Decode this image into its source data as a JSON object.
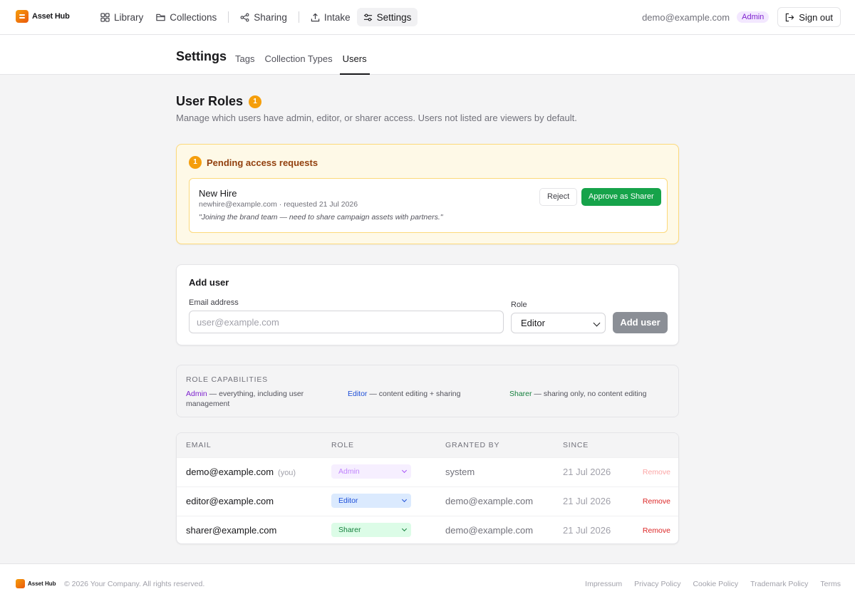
{
  "brand": {
    "name": "Asset Hub"
  },
  "nav": {
    "items": [
      {
        "label": "Library",
        "icon": "grid-icon"
      },
      {
        "label": "Collections",
        "icon": "folder-icon"
      },
      {
        "label": "Sharing",
        "icon": "share-icon"
      },
      {
        "label": "Intake",
        "icon": "upload-icon"
      },
      {
        "label": "Settings",
        "icon": "sliders-icon",
        "active": true
      }
    ]
  },
  "user": {
    "email": "demo@example.com",
    "role_badge": "Admin",
    "signout_label": "Sign out"
  },
  "settings": {
    "title": "Settings",
    "tabs": [
      "Tags",
      "Collection Types",
      "Users"
    ],
    "active_tab": "Users"
  },
  "roles": {
    "title": "User Roles",
    "count": "1",
    "description": "Manage which users have admin, editor, or sharer access. Users not listed are viewers by default."
  },
  "pending": {
    "count": "1",
    "title": "Pending access requests",
    "request": {
      "name": "New Hire",
      "meta": "newhire@example.com · requested 21 Jul 2026",
      "note": "\"Joining the brand team — need to share campaign assets with partners.\"",
      "reject_label": "Reject",
      "approve_label": "Approve as Sharer"
    }
  },
  "add_user": {
    "title": "Add user",
    "email_label": "Email address",
    "email_placeholder": "user@example.com",
    "role_label": "Role",
    "role_value": "Editor",
    "button_label": "Add user"
  },
  "capabilities": {
    "title": "ROLE CAPABILITIES",
    "items": [
      {
        "name": "Admin",
        "desc": " — everything, including user management"
      },
      {
        "name": "Editor",
        "desc": " — content editing + sharing"
      },
      {
        "name": "Sharer",
        "desc": " — sharing only, no content editing"
      }
    ]
  },
  "table": {
    "headers": [
      "EMAIL",
      "ROLE",
      "GRANTED BY",
      "SINCE"
    ],
    "rows": [
      {
        "email": "demo@example.com",
        "you": "(you)",
        "role": "Admin",
        "granted_by": "system",
        "since": "21 Jul 2026",
        "action": "Remove"
      },
      {
        "email": "editor@example.com",
        "you": "",
        "role": "Editor",
        "granted_by": "demo@example.com",
        "since": "21 Jul 2026",
        "action": "Remove"
      },
      {
        "email": "sharer@example.com",
        "you": "",
        "role": "Sharer",
        "granted_by": "demo@example.com",
        "since": "21 Jul 2026",
        "action": "Remove"
      }
    ]
  },
  "footer": {
    "brand": "Asset Hub",
    "copyright": "© 2026 Your Company. All rights reserved.",
    "links": [
      "Impressum",
      "Privacy Policy",
      "Cookie Policy",
      "Trademark Policy",
      "Terms"
    ]
  }
}
